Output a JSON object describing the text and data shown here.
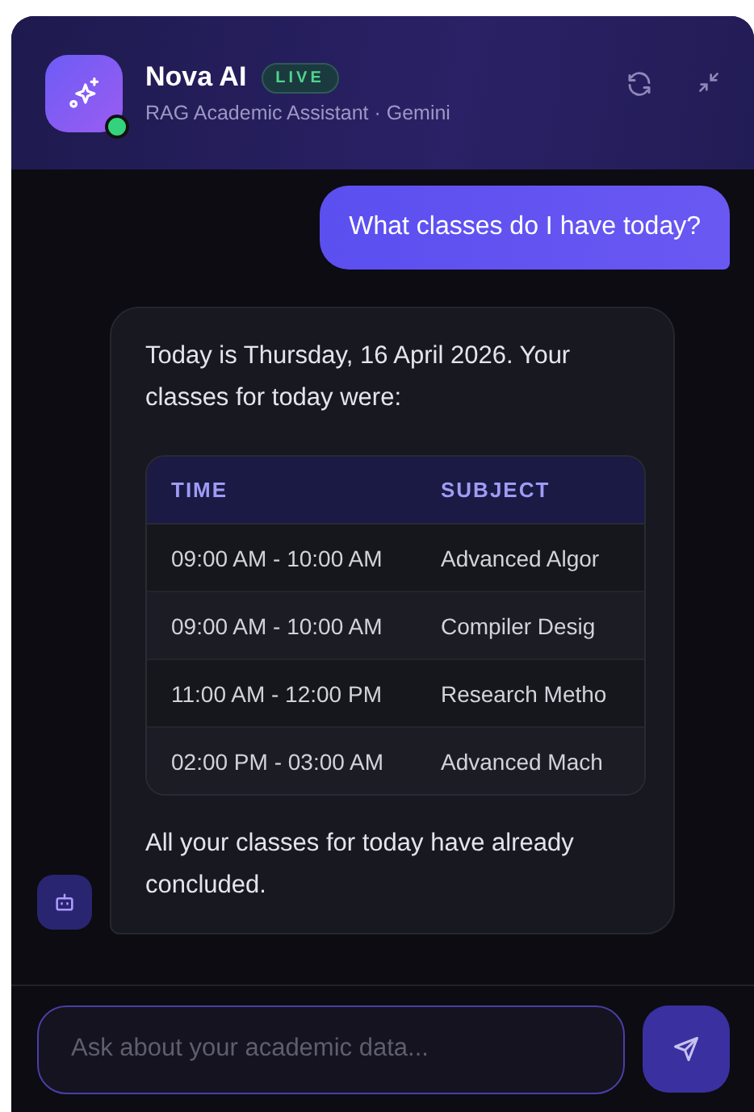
{
  "header": {
    "title": "Nova AI",
    "badge": "LIVE",
    "subtitle": "RAG Academic Assistant · Gemini",
    "online": true
  },
  "messages": [
    {
      "kind": "user",
      "text": "What classes do I have today?"
    },
    {
      "kind": "bot",
      "intro": "Today is Thursday, 16 April 2026. Your classes for today were:",
      "table": {
        "columns": [
          "TIME",
          "SUBJECT"
        ],
        "rows": [
          [
            "09:00 AM - 10:00 AM",
            "Advanced Algor"
          ],
          [
            "09:00 AM - 10:00 AM",
            "Compiler Desig"
          ],
          [
            "11:00 AM - 12:00 PM",
            "Research Metho"
          ],
          [
            "02:00 PM - 03:00 AM",
            "Advanced Mach"
          ]
        ]
      },
      "outro": "All your classes for today have already concluded."
    }
  ],
  "composer": {
    "placeholder": "Ask about your academic data..."
  }
}
